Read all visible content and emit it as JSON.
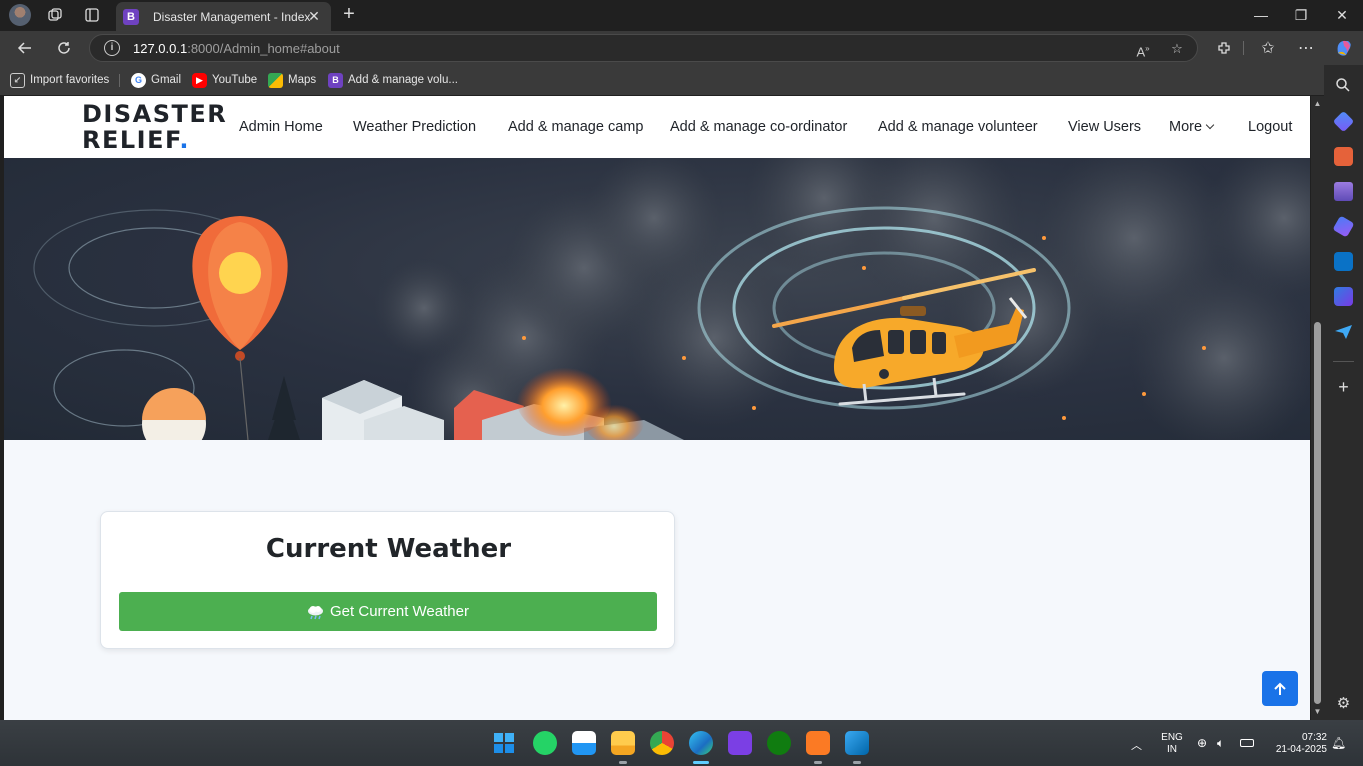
{
  "browser": {
    "active_tab_title": "Disaster Management - Index",
    "tab_favicon_letter": "B",
    "url_host": "127.0.0.1",
    "url_path": ":8000/Admin_home#about",
    "accent": "#1a73e8"
  },
  "bookmarks": [
    {
      "label": "Import favorites",
      "icon": "import-icon"
    },
    {
      "label": "Gmail",
      "icon": "google-icon"
    },
    {
      "label": "YouTube",
      "icon": "youtube-icon"
    },
    {
      "label": "Maps",
      "icon": "maps-icon"
    },
    {
      "label": "Add & manage volu...",
      "icon": "bootstrap-icon"
    }
  ],
  "site": {
    "logo_line1": "DISASTER",
    "logo_line2": "RELIEF",
    "logo_dot": ".",
    "nav": [
      "Admin Home",
      "Weather Prediction",
      "Add & manage camp",
      "Add & manage co-ordinator",
      "Add & manage volunteer",
      "View Users",
      "More",
      "Logout"
    ]
  },
  "weather": {
    "title": "Current Weather",
    "button_label": "Get Current Weather",
    "button_color": "#4caf50"
  },
  "taskbar": {
    "lang_line1": "ENG",
    "lang_line2": "IN",
    "time": "07:32",
    "date": "21-04-2025"
  }
}
